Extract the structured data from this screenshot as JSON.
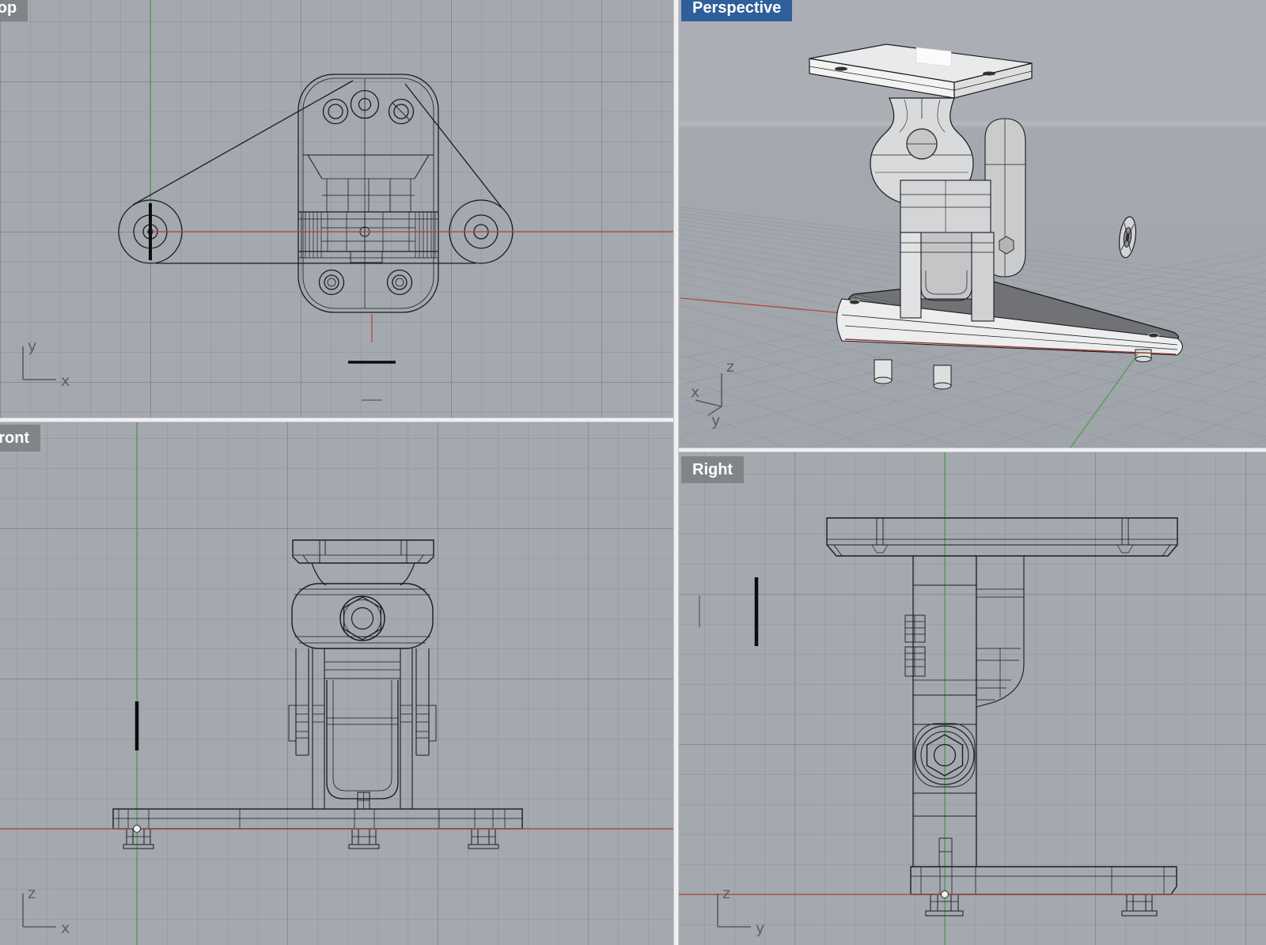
{
  "viewports": {
    "top": {
      "label": "Top",
      "active": false,
      "axis_vertical": "y",
      "axis_horizontal": "x"
    },
    "perspective": {
      "label": "Perspective",
      "active": true,
      "axis_z": "z",
      "axis_x": "x",
      "axis_y": "y"
    },
    "front": {
      "label": "Front",
      "active": false,
      "axis_vertical": "z",
      "axis_horizontal": "x"
    },
    "right": {
      "label": "Right",
      "active": false,
      "axis_vertical": "z",
      "axis_horizontal": "y"
    }
  },
  "colors": {
    "viewport_bg": "#a4a8af",
    "grid_minor": "#979ba3",
    "grid_major": "#8f939b",
    "axis_x_red": "#b2483f",
    "axis_x_red_occluded": "#8e3a34",
    "axis_y_green": "#4f9e55",
    "active_label_bg": "#2e5f9b",
    "inactive_label_bg": "#7d7f82",
    "label_text": "#ffffff",
    "divider": "#f0f0f2",
    "wireframe_edge": "#1b1c1e",
    "shaded_surface": "#d9dadb",
    "base_top_face": "#707276"
  }
}
